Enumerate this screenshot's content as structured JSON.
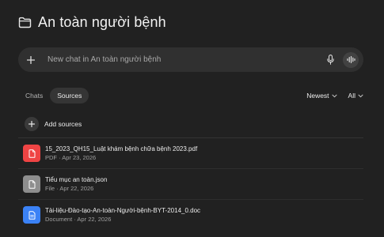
{
  "project": {
    "title": "An toàn người bệnh",
    "icon": "folder-icon"
  },
  "composer": {
    "placeholder": "New chat in An toàn người bệnh",
    "add_icon": "plus-icon",
    "mic_icon": "microphone-icon",
    "voice_icon": "voice-waveform-icon"
  },
  "tabs": [
    {
      "label": "Chats",
      "active": false
    },
    {
      "label": "Sources",
      "active": true
    }
  ],
  "filters": {
    "sort_label": "Newest",
    "type_label": "All"
  },
  "add_sources": {
    "label": "Add sources"
  },
  "sources": [
    {
      "name": "15_2023_QH15_Luật khám bệnh chữa bệnh 2023.pdf",
      "meta": "PDF · Apr 23, 2026",
      "icon": "pdf-file-icon",
      "color": "#ef4444"
    },
    {
      "name": "Tiểu mục an toàn.json",
      "meta": "File · Apr 22, 2026",
      "icon": "generic-file-icon",
      "color": "#8e8e8e"
    },
    {
      "name": "Tài-liệu-Đào-tạo-An-toàn-Người-bệnh-BYT-2014_0.doc",
      "meta": "Document · Apr 22, 2026",
      "icon": "document-file-icon",
      "color": "#3b82f6"
    }
  ],
  "colors": {
    "background": "#212121",
    "composer": "#303030",
    "active_tab": "#353535"
  }
}
